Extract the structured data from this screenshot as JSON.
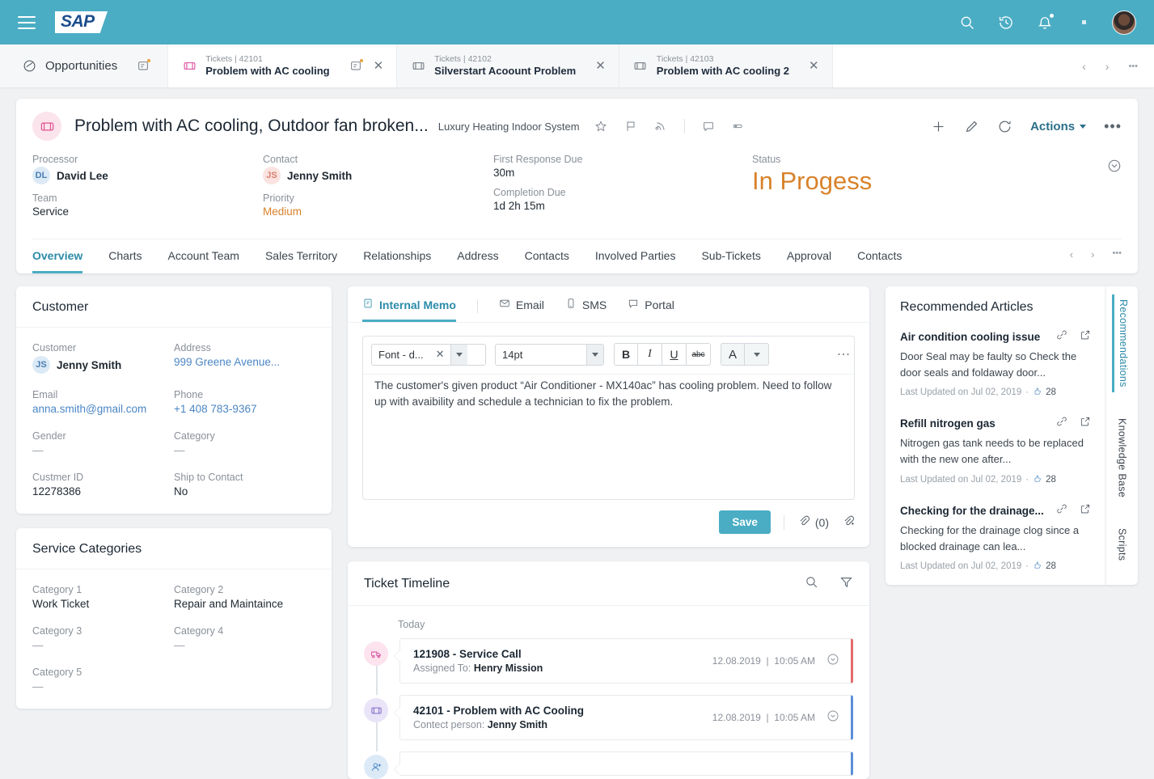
{
  "topbar": {
    "logo": "SAP",
    "icons": [
      "search-icon",
      "history-icon",
      "bell-icon",
      "square-dot-icon",
      "avatar"
    ]
  },
  "tabs": [
    {
      "sub": "",
      "title": "Opportunities",
      "icon": "opportunity-icon",
      "active": false,
      "closable": false
    },
    {
      "sub": "Tickets | 42101",
      "title": "Problem with AC cooling",
      "icon": "ticket-icon",
      "active": true,
      "closable": true
    },
    {
      "sub": "Tickets | 42102",
      "title": "Silverstart Acoount Problem",
      "icon": "ticket-icon",
      "active": false,
      "closable": true
    },
    {
      "sub": "Tickets | 42103",
      "title": "Problem with AC cooling 2",
      "icon": "ticket-icon",
      "active": false,
      "closable": true
    }
  ],
  "tabstrip_nav": {
    "prev": "‹",
    "next": "›",
    "more": "•••"
  },
  "header": {
    "title": "Problem with AC cooling, Outdoor fan broken...",
    "subtitle": "Luxury Heating Indoor System",
    "actions_label": "Actions",
    "more": "•••",
    "facts": {
      "processor_label": "Processor",
      "processor_initials": "DL",
      "processor_value": "David Lee",
      "team_label": "Team",
      "team_value": "Service",
      "contact_label": "Contact",
      "contact_initials": "JS",
      "contact_value": "Jenny Smith",
      "priority_label": "Priority",
      "priority_value": "Medium",
      "first_response_label": "First Response Due",
      "first_response_value": "30m",
      "completion_label": "Completion Due",
      "completion_value": "1d  2h  15m",
      "status_label": "Status",
      "status_value": "In Progess"
    }
  },
  "nav_tabs": [
    {
      "label": "Overview",
      "active": true
    },
    {
      "label": "Charts",
      "active": false
    },
    {
      "label": "Account Team",
      "active": false
    },
    {
      "label": "Sales Territory",
      "active": false
    },
    {
      "label": "Relationships",
      "active": false
    },
    {
      "label": "Address",
      "active": false
    },
    {
      "label": "Contacts",
      "active": false
    },
    {
      "label": "Involved Parties",
      "active": false
    },
    {
      "label": "Sub-Tickets",
      "active": false
    },
    {
      "label": "Approval",
      "active": false
    },
    {
      "label": "Contacts",
      "active": false
    }
  ],
  "nav_controls": {
    "prev": "‹",
    "next": "›",
    "more": "•••"
  },
  "customer_card": {
    "heading": "Customer",
    "fields": [
      {
        "label": "Customer",
        "value": "Jenny Smith",
        "initials": "JS",
        "style": "bold"
      },
      {
        "label": "Address",
        "value": "999 Greene Avenue...",
        "style": "link"
      },
      {
        "label": "Email",
        "value": "anna.smith@gmail.com",
        "style": "link"
      },
      {
        "label": "Phone",
        "value": "+1 408 783-9367",
        "style": "link"
      },
      {
        "label": "Gender",
        "value": "—",
        "style": "dash"
      },
      {
        "label": "Category",
        "value": "—",
        "style": "dash"
      },
      {
        "label": "Custmer ID",
        "value": "12278386",
        "style": "normal"
      },
      {
        "label": "Ship to Contact",
        "value": "No",
        "style": "normal"
      }
    ]
  },
  "service_categories_card": {
    "heading": "Service Categories",
    "fields": [
      {
        "label": "Category 1",
        "value": "Work Ticket",
        "style": "normal"
      },
      {
        "label": "Category 2",
        "value": "Repair and Maintaince",
        "style": "normal"
      },
      {
        "label": "Category 3",
        "value": "—",
        "style": "dash"
      },
      {
        "label": "Category 4",
        "value": "—",
        "style": "dash"
      },
      {
        "label": "Category 5",
        "value": "—",
        "style": "dash"
      }
    ]
  },
  "memo_card": {
    "tabs": [
      {
        "label": "Internal Memo",
        "icon": "note-icon",
        "active": true
      },
      {
        "label": "Email",
        "icon": "envelope-icon",
        "active": false
      },
      {
        "label": "SMS",
        "icon": "mobile-icon",
        "active": false
      },
      {
        "label": "Portal",
        "icon": "chat-icon",
        "active": false
      }
    ],
    "toolbar": {
      "font_value": "Font - d...",
      "font_clear": "✕",
      "size_value": "14pt",
      "bold": "B",
      "italic": "I",
      "underline": "U",
      "strike": "abc",
      "color": "A",
      "overflow": "⋮"
    },
    "text": "The customer's given product “Air Conditioner - MX140ac” has cooling problem. Need to follow up with avaibility and schedule a technician to fix the problem.",
    "save_label": "Save",
    "attachment_count": "(0)"
  },
  "timeline_card": {
    "heading": "Ticket Timeline",
    "icons": [
      "search-icon",
      "filter-icon"
    ],
    "group_label": "Today",
    "items": [
      {
        "title": "121908 - Service Call",
        "meta_label": "Assigned To:",
        "meta_value": "Henry Mission",
        "date": "12.08.2019",
        "time": "10:05 AM",
        "badge": "pink",
        "badge_icon": "service-truck-icon",
        "accent": "red"
      },
      {
        "title": "42101 - Problem with AC Cooling",
        "meta_label": "Contect person:",
        "meta_value": "Jenny Smith",
        "date": "12.08.2019",
        "time": "10:05 AM",
        "badge": "purple",
        "badge_icon": "ticket-icon",
        "accent": "blue"
      },
      {
        "title": "",
        "meta_label": "",
        "meta_value": "",
        "date": "",
        "time": "",
        "badge": "blue",
        "badge_icon": "add-person-icon",
        "accent": "blue"
      }
    ]
  },
  "right_panel": {
    "heading": "Recommended Articles",
    "articles": [
      {
        "title": "Air condition cooling issue",
        "desc": "Door Seal may be faulty so Check the door seals and foldaway door...",
        "meta": "Last Updated on Jul 02, 2019",
        "sep": "·",
        "likes": "28"
      },
      {
        "title": "Refill nitrogen gas",
        "desc": "Nitrogen gas tank needs to be replaced with the new one after...",
        "meta": "Last Updated on Jul 02, 2019",
        "sep": "·",
        "likes": "28"
      },
      {
        "title": "Checking for the drainage...",
        "desc": "Checking for the drainage clog since a blocked drainage can lea...",
        "meta": "Last Updated on Jul 02, 2019",
        "sep": "·",
        "likes": "28"
      }
    ],
    "rail": [
      {
        "label": "Recommendations",
        "active": true
      },
      {
        "label": "Knowledge Base",
        "active": false
      },
      {
        "label": "Scripts",
        "active": false
      }
    ]
  },
  "colors": {
    "brand_teal": "#4aadc4",
    "status_orange": "#d9822b",
    "accent_link": "#4b86c4",
    "accent_red": "#e46a6a",
    "accent_blue": "#5b8fd6"
  }
}
